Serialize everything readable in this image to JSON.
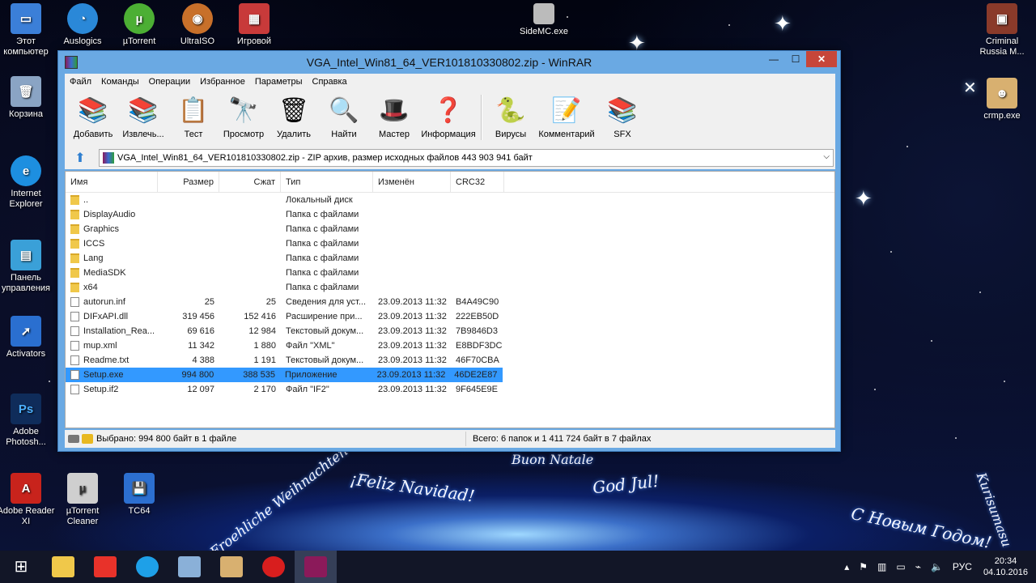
{
  "desktop": {
    "icons_left": [
      {
        "label": "Этот компьютер",
        "icon": "computer-icon",
        "color": "#3b7fd8"
      },
      {
        "label": "Корзина",
        "icon": "recycle-bin-icon",
        "color": "#8aa4c4"
      },
      {
        "label": "Internet Explorer",
        "icon": "internet-explorer-icon",
        "color": "#1d8fe0"
      },
      {
        "label": "Панель управления",
        "icon": "control-panel-icon",
        "color": "#3aa0d8"
      },
      {
        "label": "Activators",
        "icon": "activators-icon",
        "color": "#2a6fd0"
      },
      {
        "label": "Adobe Photosh...",
        "icon": "photoshop-icon",
        "color": "#0f2c5a"
      },
      {
        "label": "Adobe Reader XI",
        "icon": "adobe-reader-icon",
        "color": "#c8231c"
      }
    ],
    "icons_top": [
      {
        "label": "Auslogics",
        "icon": "auslogics-icon",
        "color": "#2a88d8"
      },
      {
        "label": "µTorrent",
        "icon": "utorrent-icon",
        "color": "#4caf34"
      },
      {
        "label": "UltraISO",
        "icon": "ultraiso-icon",
        "color": "#c8702a"
      },
      {
        "label": "Игровой",
        "icon": "game-icon",
        "color": "#c83a3a"
      },
      {
        "label": "SideMC.exe",
        "icon": "sidemc-icon",
        "color": "#bbbbbb"
      }
    ],
    "icons_bottom": [
      {
        "label": "µTorrent Cleaner",
        "icon": "utorrent-cleaner-icon",
        "color": "#cfcfcf"
      },
      {
        "label": "TC64",
        "icon": "tc64-icon",
        "color": "#2c6fd0"
      }
    ],
    "icons_right": [
      {
        "label": "Criminal Russia M...",
        "icon": "criminal-russia-icon",
        "color": "#8a3a2a"
      },
      {
        "label": "crmp.exe",
        "icon": "crmp-icon",
        "color": "#d8b070"
      }
    ],
    "greetings": [
      "Froehliche Weihnachten",
      "¡Feliz Navidad!",
      "God Jul!",
      "С Новым Годом!",
      "Buon Natale",
      "Kurisumasu"
    ]
  },
  "window": {
    "title": "VGA_Intel_Win81_64_VER101810330802.zip - WinRAR",
    "minimize_glyph": "—",
    "maximize_glyph": "☐",
    "close_glyph": "✕",
    "menu": [
      "Файл",
      "Команды",
      "Операции",
      "Избранное",
      "Параметры",
      "Справка"
    ],
    "toolbar": [
      {
        "label": "Добавить",
        "icon": "add-archive-icon",
        "glyph": "📚"
      },
      {
        "label": "Извлечь...",
        "icon": "extract-icon",
        "glyph": "📚"
      },
      {
        "label": "Тест",
        "icon": "test-icon",
        "glyph": "📋"
      },
      {
        "label": "Просмотр",
        "icon": "view-icon",
        "glyph": "🔭"
      },
      {
        "label": "Удалить",
        "icon": "delete-icon",
        "glyph": "🗑"
      },
      {
        "label": "Найти",
        "icon": "find-icon",
        "glyph": "🔍"
      },
      {
        "label": "Мастер",
        "icon": "wizard-icon",
        "glyph": "🎩"
      },
      {
        "label": "Информация",
        "icon": "info-icon",
        "glyph": "❓"
      },
      {
        "label": "Вирусы",
        "icon": "virus-scan-icon",
        "glyph": "🐍"
      },
      {
        "label": "Комментарий",
        "icon": "comment-icon",
        "glyph": "📝"
      },
      {
        "label": "SFX",
        "icon": "sfx-icon",
        "glyph": "📚"
      }
    ],
    "address": "VGA_Intel_Win81_64_VER101810330802.zip - ZIP архив, размер исходных файлов 443 903 941 байт",
    "columns": {
      "name": "Имя",
      "size": "Размер",
      "packed": "Сжат",
      "type": "Тип",
      "modified": "Изменён",
      "crc": "CRC32"
    },
    "rows": [
      {
        "name": "..",
        "size": "",
        "packed": "",
        "type": "Локальный диск",
        "modified": "",
        "crc": "",
        "kind": "folder",
        "selected": false
      },
      {
        "name": "DisplayAudio",
        "size": "",
        "packed": "",
        "type": "Папка с файлами",
        "modified": "",
        "crc": "",
        "kind": "folder",
        "selected": false
      },
      {
        "name": "Graphics",
        "size": "",
        "packed": "",
        "type": "Папка с файлами",
        "modified": "",
        "crc": "",
        "kind": "folder",
        "selected": false
      },
      {
        "name": "ICCS",
        "size": "",
        "packed": "",
        "type": "Папка с файлами",
        "modified": "",
        "crc": "",
        "kind": "folder",
        "selected": false
      },
      {
        "name": "Lang",
        "size": "",
        "packed": "",
        "type": "Папка с файлами",
        "modified": "",
        "crc": "",
        "kind": "folder",
        "selected": false
      },
      {
        "name": "MediaSDK",
        "size": "",
        "packed": "",
        "type": "Папка с файлами",
        "modified": "",
        "crc": "",
        "kind": "folder",
        "selected": false
      },
      {
        "name": "x64",
        "size": "",
        "packed": "",
        "type": "Папка с файлами",
        "modified": "",
        "crc": "",
        "kind": "folder",
        "selected": false
      },
      {
        "name": "autorun.inf",
        "size": "25",
        "packed": "25",
        "type": "Сведения для уст...",
        "modified": "23.09.2013 11:32",
        "crc": "B4A49C90",
        "kind": "file",
        "selected": false
      },
      {
        "name": "DIFxAPI.dll",
        "size": "319 456",
        "packed": "152 416",
        "type": "Расширение при...",
        "modified": "23.09.2013 11:32",
        "crc": "222EB50D",
        "kind": "file",
        "selected": false
      },
      {
        "name": "Installation_Rea...",
        "size": "69 616",
        "packed": "12 984",
        "type": "Текстовый докум...",
        "modified": "23.09.2013 11:32",
        "crc": "7B9846D3",
        "kind": "file",
        "selected": false
      },
      {
        "name": "mup.xml",
        "size": "11 342",
        "packed": "1 880",
        "type": "Файл \"XML\"",
        "modified": "23.09.2013 11:32",
        "crc": "E8BDF3DC",
        "kind": "file",
        "selected": false
      },
      {
        "name": "Readme.txt",
        "size": "4 388",
        "packed": "1 191",
        "type": "Текстовый докум...",
        "modified": "23.09.2013 11:32",
        "crc": "46F70CBA",
        "kind": "file",
        "selected": false
      },
      {
        "name": "Setup.exe",
        "size": "994 800",
        "packed": "388 535",
        "type": "Приложение",
        "modified": "23.09.2013 11:32",
        "crc": "46DE2E87",
        "kind": "file",
        "selected": true
      },
      {
        "name": "Setup.if2",
        "size": "12 097",
        "packed": "2 170",
        "type": "Файл \"IF2\"",
        "modified": "23.09.2013 11:32",
        "crc": "9F645E9E",
        "kind": "file",
        "selected": false
      }
    ],
    "status_left": "Выбрано: 994 800 байт в 1 файле",
    "status_right": "Всего: 6 папок и 1 411 724 байт в 7 файлах"
  },
  "taskbar": {
    "apps": [
      {
        "icon": "start-icon",
        "color": "#ffffff"
      },
      {
        "icon": "file-explorer-icon",
        "color": "#f0c84a"
      },
      {
        "icon": "yandex-browser-icon",
        "color": "#e8322a"
      },
      {
        "icon": "skype-icon",
        "color": "#1ea0e8"
      },
      {
        "icon": "task-manager-icon",
        "color": "#8ab0d8"
      },
      {
        "icon": "recycle-bin-icon",
        "color": "#d8b070"
      },
      {
        "icon": "recorder-icon",
        "color": "#d81e1e"
      },
      {
        "icon": "winrar-icon",
        "color": "#8b1a5a"
      }
    ],
    "language": "РУС",
    "time": "20:34",
    "date": "04.10.2016"
  }
}
